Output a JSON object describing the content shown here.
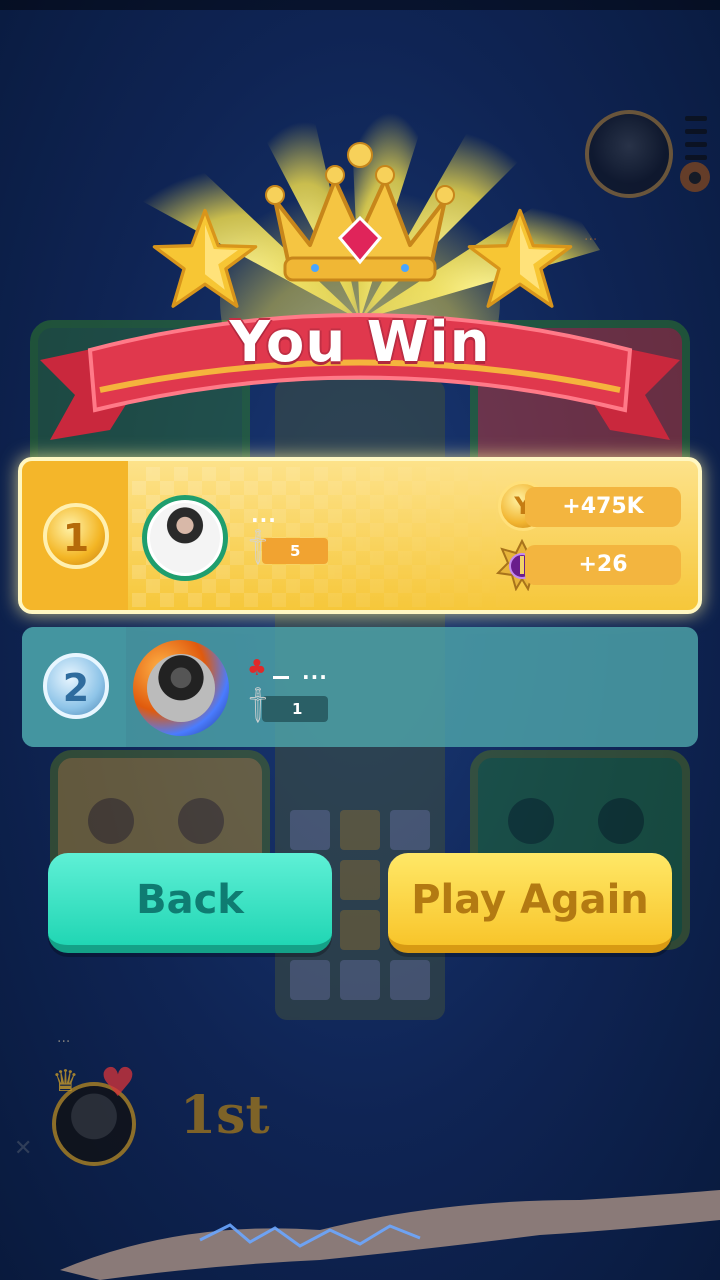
{
  "banner": {
    "title": "You Win"
  },
  "opponent_top": {
    "name_dots": "···"
  },
  "results": [
    {
      "rank": "1",
      "name_dots": "···",
      "sword_count": "5",
      "coins": "+475K",
      "trophies": "+26",
      "coin_symbol": "Y"
    },
    {
      "rank": "2",
      "name_dots": "···",
      "sword_count": "1",
      "flag_icon": "maple-leaf-flag"
    }
  ],
  "buttons": {
    "back": "Back",
    "play_again": "Play Again"
  },
  "self": {
    "place": "1st",
    "name_dots": "···"
  },
  "colors": {
    "background": "#0f2454",
    "winner_row": "#f6c73a",
    "second_row": "#4ea5aa",
    "back_button": "#21d6b4",
    "play_again_button": "#f8c52b",
    "ribbon": "#e0384d"
  }
}
